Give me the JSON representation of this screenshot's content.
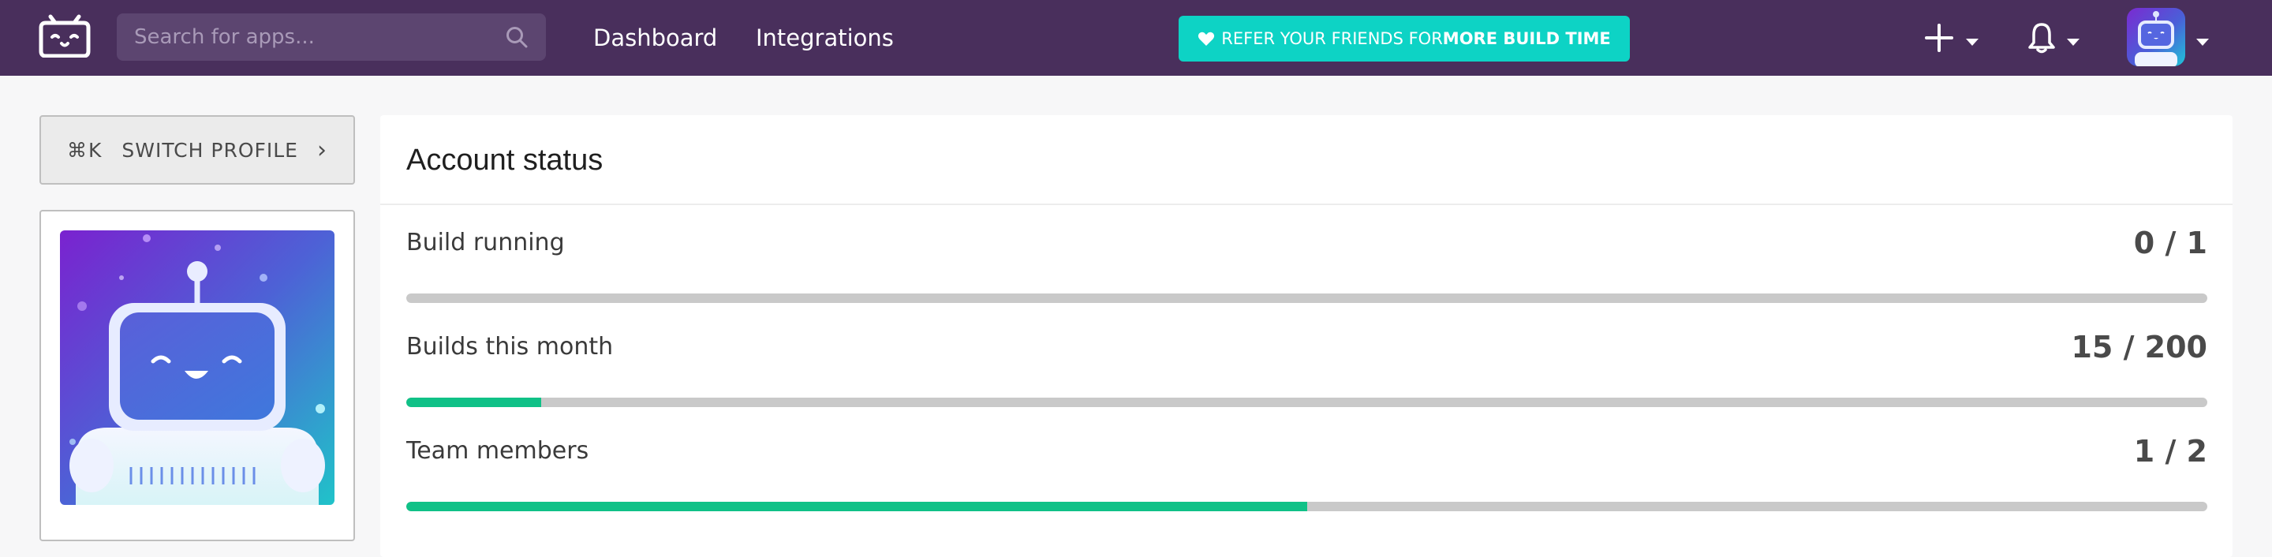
{
  "header": {
    "search": {
      "placeholder": "Search for apps...",
      "value": ""
    },
    "nav": [
      {
        "label": "Dashboard"
      },
      {
        "label": "Integrations"
      }
    ],
    "refer": {
      "text_regular": "REFER YOUR FRIENDS FOR ",
      "text_bold": "MORE BUILD TIME"
    },
    "icons": {
      "logo": "bitrise-bot-logo",
      "search": "search-icon",
      "add": "plus-icon",
      "notifications": "bell-icon",
      "caret": "chevron-down-icon"
    }
  },
  "sidebar": {
    "switch_profile": {
      "shortcut": "⌘K",
      "label": "SWITCH PROFILE",
      "arrow": "›"
    }
  },
  "account_status": {
    "title": "Account status",
    "stats": [
      {
        "label": "Build running",
        "value": "0 / 1",
        "fraction": 0
      },
      {
        "label": "Builds this month",
        "value": "15 / 200",
        "fraction": 0.075
      },
      {
        "label": "Team members",
        "value": "1 / 2",
        "fraction": 0.5
      }
    ]
  },
  "colors": {
    "topbar": "#492f5c",
    "refer_button": "#0dd3c5",
    "progress_fill": "#10c187",
    "progress_track": "#c9c9c9"
  }
}
